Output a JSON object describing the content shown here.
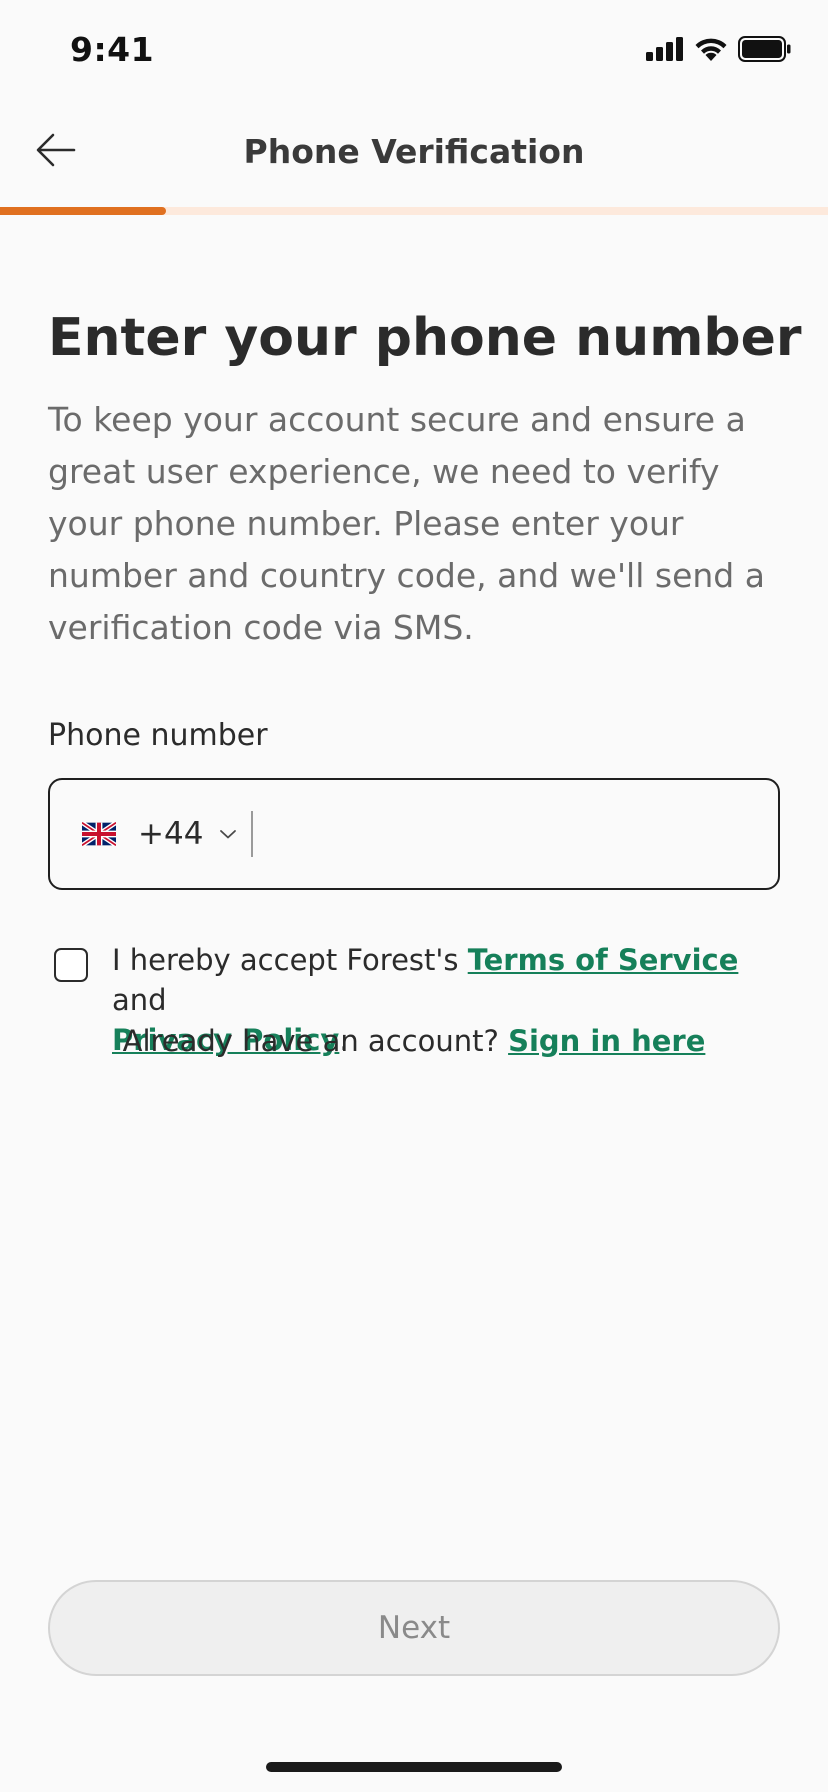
{
  "status_bar": {
    "time": "9:41",
    "icons": [
      "cellular-signal-icon",
      "wifi-icon",
      "battery-icon"
    ]
  },
  "nav": {
    "title": "Phone Verification",
    "back_icon": "arrow-left-icon"
  },
  "progress": {
    "fraction": 0.2,
    "fill_color": "#e07020",
    "track_color": "#fde9dc"
  },
  "main": {
    "heading": "Enter your phone number",
    "description": "To keep your account secure and ensure a great user experience, we need to verify your phone number. Please enter your number and country code, and we'll send a verification code via SMS."
  },
  "phone_field": {
    "label": "Phone number",
    "country_flag": "uk-flag-icon",
    "country_code": "+44",
    "value": "",
    "placeholder": ""
  },
  "consent": {
    "checked": false,
    "prefix": "I hereby accept Forest's ",
    "terms_label": "Terms of Service",
    "middle": " and",
    "privacy_label": "Privacy Policy",
    "suffix": "."
  },
  "signin": {
    "prompt": "Already have an account? ",
    "link_label": "Sign in here"
  },
  "next_button": {
    "label": "Next",
    "disabled": true
  },
  "colors": {
    "link": "#16805a",
    "accent": "#e07020",
    "background": "#fafafa"
  }
}
